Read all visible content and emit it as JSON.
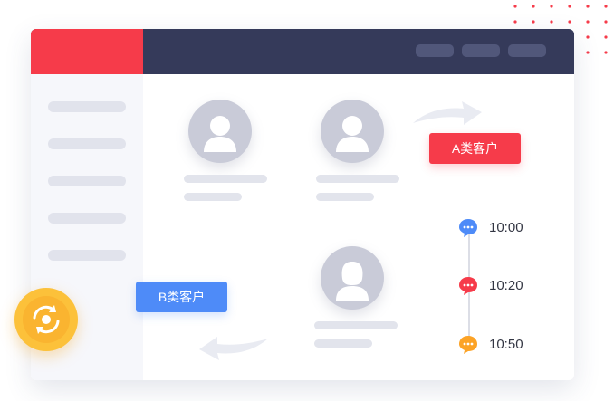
{
  "customer_tags": {
    "a_label": "A类客户",
    "b_label": "B类客户"
  },
  "timeline": [
    {
      "time": "10:00",
      "icon": "chat-bubble-icon",
      "color": "#4e8bf8"
    },
    {
      "time": "10:20",
      "icon": "chat-bubble-icon",
      "color": "#f63b4a"
    },
    {
      "time": "10:50",
      "icon": "chat-bubble-icon",
      "color": "#fca326"
    }
  ],
  "colors": {
    "accent_red": "#f63b4a",
    "accent_blue": "#4e8bf8",
    "accent_orange": "#fca326",
    "titlebar": "#353a5a",
    "sync_badge": "#fcc13a"
  },
  "icons": {
    "avatars": [
      "male-user-icon",
      "male-user-icon",
      "female-user-icon"
    ],
    "badge": "sync-icon",
    "arrows": [
      "curved-arrow-right-icon",
      "curved-arrow-left-icon"
    ]
  }
}
